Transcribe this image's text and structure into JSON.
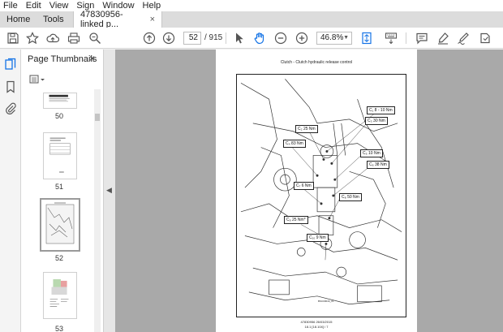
{
  "menu": [
    "File",
    "Edit",
    "View",
    "Sign",
    "Window",
    "Help"
  ],
  "tabs": {
    "home": "Home",
    "tools": "Tools",
    "document": "47830956-linked p...",
    "close": "×"
  },
  "toolbar": {
    "current_page": "52",
    "total_pages": "/ 915",
    "zoom": "46.8%"
  },
  "panel": {
    "title": "Page Thumbnails",
    "close": "×",
    "thumbnails": [
      {
        "label": "50"
      },
      {
        "label": "51"
      },
      {
        "label": "52"
      },
      {
        "label": "53"
      }
    ]
  },
  "page": {
    "heading": "Clutch - Clutch hydraulic release control",
    "ref_code": "BSC00040_01",
    "footer_line1": "47830956 26/03/2015",
    "footer_line2": "18.1 [18.104] / 7",
    "torque_labels": [
      "C₁  8 - 10 Nm",
      "C₂  25 Nm",
      "C₃  30 Nm",
      "C₄  83 Nm",
      "C₅  10 Nm",
      "C₆  38 Nm",
      "C₇  6 Nm",
      "C₈  50 Nm",
      "C₉  25 Nm*",
      "C₁₀  9 Nm"
    ]
  },
  "colors": {
    "doc_background": "#a9a9a9",
    "accent_blue": "#1473e6"
  }
}
